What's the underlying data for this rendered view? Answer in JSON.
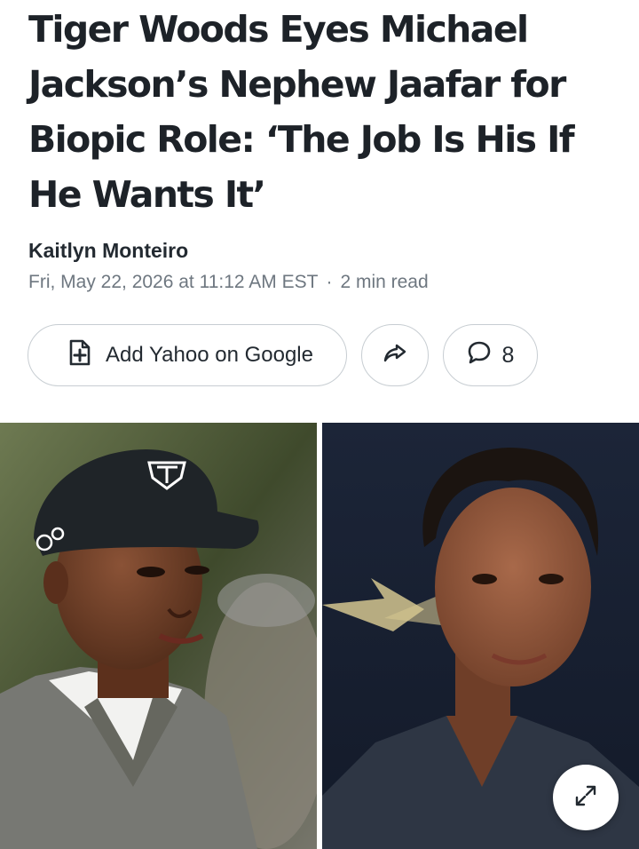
{
  "article": {
    "headline": "Tiger Woods Eyes Michael Jackson’s Nephew Jaafar for Biopic Role: ‘The Job Is His If He Wants It’",
    "author": "Kaitlyn Monteiro",
    "date": "Fri, May 22, 2026 at 11:12 AM EST",
    "separator": "·",
    "read_time": "2 min read"
  },
  "actions": {
    "add_google_label": "Add Yahoo on Google",
    "add_google_icon": "add-document-icon",
    "share_icon": "share-arrow-icon",
    "comment_icon": "comment-bubble-icon",
    "comment_count": "8"
  },
  "media": {
    "left_image": "photo of Tiger Woods in a black TW golf cap and grey sweater vest",
    "right_image": "photo of Jaafar Jackson with curly hair on a red carpet",
    "expand_icon": "expand-icon"
  }
}
